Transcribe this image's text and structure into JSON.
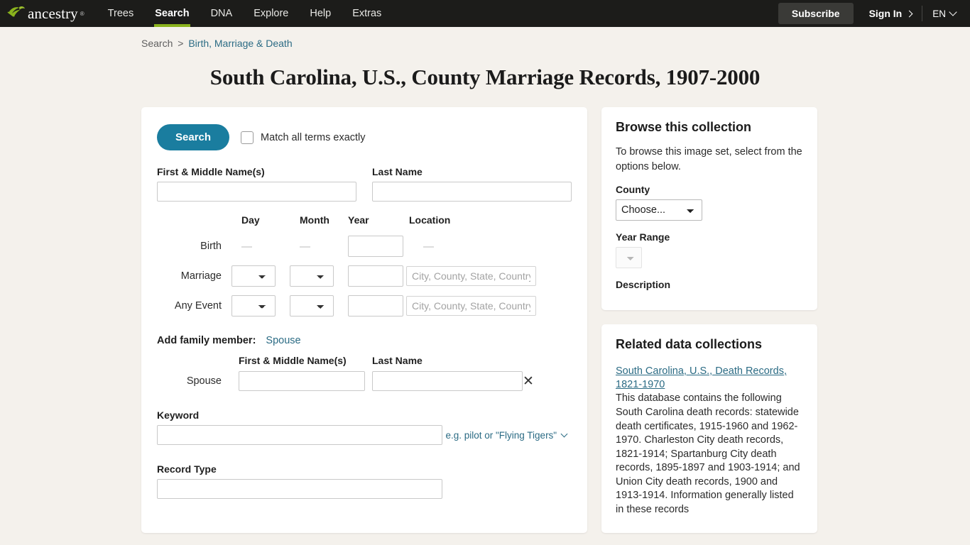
{
  "navbar": {
    "brand": "ancestry",
    "brand_tm": "®",
    "links": [
      {
        "label": "Trees",
        "active": false
      },
      {
        "label": "Search",
        "active": true
      },
      {
        "label": "DNA",
        "active": false
      },
      {
        "label": "Explore",
        "active": false
      },
      {
        "label": "Help",
        "active": false
      },
      {
        "label": "Extras",
        "active": false
      }
    ],
    "subscribe_label": "Subscribe",
    "signin_label": "Sign In",
    "language": "EN",
    "accent_green": "#8ab31d",
    "background": "#1c1c1a"
  },
  "breadcrumb": {
    "root": "Search",
    "separator": ">",
    "current": "Birth, Marriage & Death"
  },
  "page_title": "South Carolina, U.S., County Marriage Records, 1907-2000",
  "search_form": {
    "search_button": "Search",
    "match_exactly_label": "Match all terms exactly",
    "first_name_label": "First & Middle Name(s)",
    "first_name_value": "",
    "last_name_label": "Last Name",
    "last_name_value": "",
    "date_headers": {
      "day": "Day",
      "month": "Month",
      "year": "Year",
      "location": "Location"
    },
    "rows": [
      {
        "label": "Birth",
        "day": "—",
        "month": "—",
        "year_value": "",
        "location": "—",
        "has_selects": false
      },
      {
        "label": "Marriage",
        "day": "",
        "month": "",
        "year_value": "",
        "location_placeholder": "City, County, State, Country",
        "has_selects": true
      },
      {
        "label": "Any Event",
        "day": "",
        "month": "",
        "year_value": "",
        "location_placeholder": "City, County, State, Country",
        "has_selects": true
      }
    ],
    "add_family_label": "Add family member:",
    "add_family_link": "Spouse",
    "spouse_section": {
      "first_name_header": "First & Middle Name(s)",
      "last_name_header": "Last Name",
      "row_label": "Spouse",
      "first_name_value": "",
      "last_name_value": "",
      "remove_icon": "✕"
    },
    "keyword_label": "Keyword",
    "keyword_value": "",
    "keyword_hint": "e.g. pilot or \"Flying Tigers\"",
    "record_type_label": "Record Type",
    "record_type_value": "",
    "accent_button": "#1a7d9f"
  },
  "browse_panel": {
    "title": "Browse this collection",
    "intro": "To browse this image set, select from the options below.",
    "county_label": "County",
    "county_selected": "Choose...",
    "year_range_label": "Year Range",
    "year_range_selected": "",
    "description_label": "Description"
  },
  "related_panel": {
    "title": "Related data collections",
    "items": [
      {
        "link": "South Carolina, U.S., Death Records, 1821-1970",
        "description": "This database contains the following South Carolina death records: statewide death certificates, 1915-1960 and 1962-1970. Charleston City death records, 1821-1914; Spartanburg City death records, 1895-1897 and 1903-1914; and Union City death records, 1900 and 1913-1914. Information generally listed in these records"
      }
    ]
  }
}
